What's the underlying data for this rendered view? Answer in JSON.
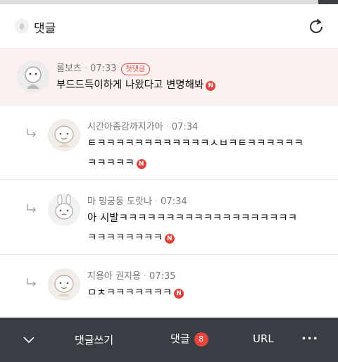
{
  "header": {
    "title": "댓글",
    "bell_icon": "bell-icon",
    "refresh_icon": "refresh-icon"
  },
  "comments": [
    {
      "author": "롬보츠",
      "time": "07:33",
      "badge": "첫댓글",
      "text": "부드드득이하게 나왔다고 변명해봐",
      "new_mark": "N",
      "highlighted": true
    },
    {
      "author": "시간아좀감까지가아",
      "time": "07:34",
      "text_line1": "ㅌㅋㅋㅋㅋㅋㅋㅋㅋㅋㅋㅋㅋㅅㅂㅋㅌㅋㅋㅋㅋㅋㅋ",
      "text_line2": "ㅋㅋㅋㅋㅋ",
      "new_mark": "N",
      "reply": true
    },
    {
      "author": "마 밍궁둥 도랏나",
      "time": "07:34",
      "text_line1": "아 시발ㅋㅋㅋㅋㅋㅋㅋㅋㅋㅋㅋㅋㅋㅋㅋㅋㅋㅋㅋ",
      "text_line2": "ㅋㅋㅋㅋㅋㅋㅋㅋ",
      "new_mark": "N",
      "reply": true
    },
    {
      "author": "지용아 권지용",
      "time": "07:35",
      "text": "ㅁㅊㅋㅋㅋㅋㅋㅋㅋ",
      "new_mark": "N",
      "reply": true
    }
  ],
  "bottom_bar": {
    "collapse_icon": "chevron-down-icon",
    "write_label": "댓글쓰기",
    "comments_label": "댓글",
    "comments_count": "8",
    "url_label": "URL",
    "more_label": "•••"
  },
  "colors": {
    "accent": "#e0433d",
    "highlight_bg": "#fbf1ef",
    "bottom_bar_bg": "#3a3e44"
  }
}
